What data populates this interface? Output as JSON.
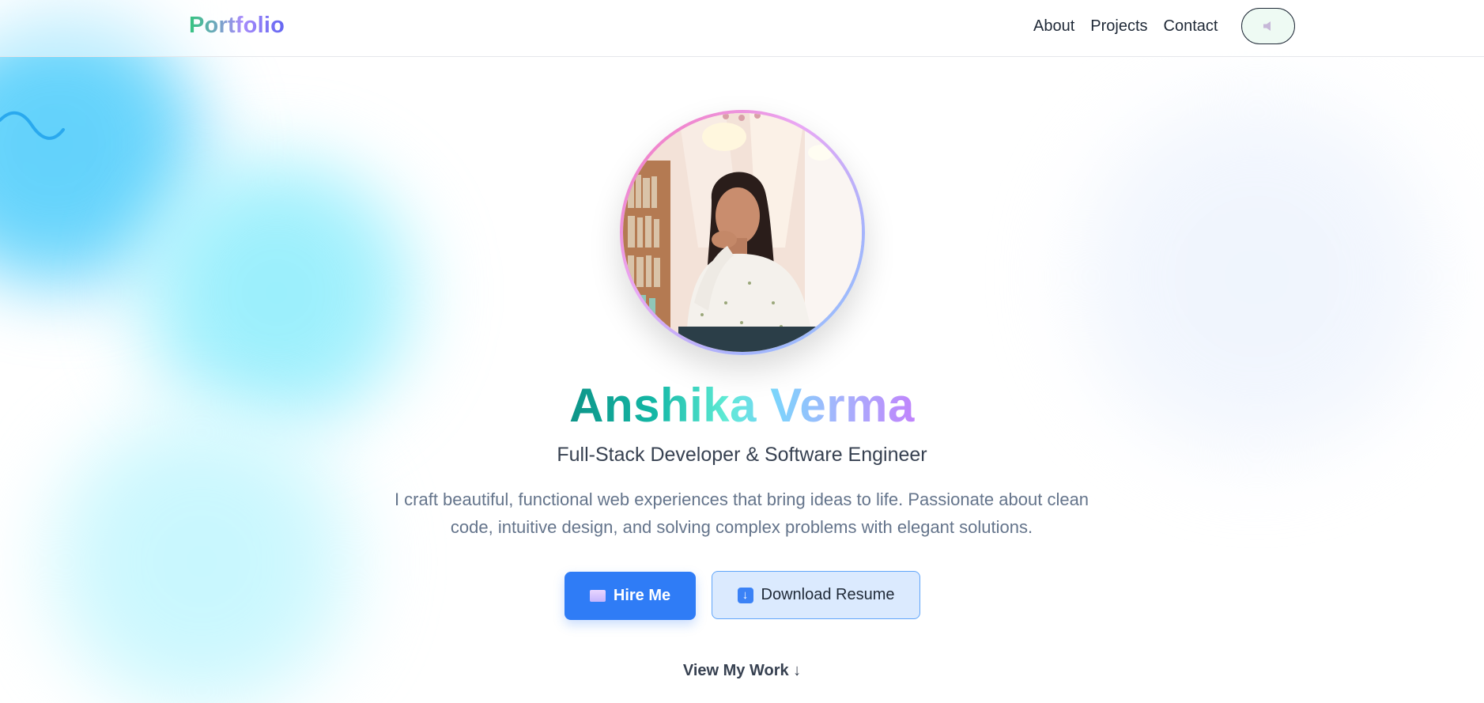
{
  "nav": {
    "logo": "Portfolio",
    "links": [
      {
        "label": "About"
      },
      {
        "label": "Projects"
      },
      {
        "label": "Contact"
      }
    ],
    "sound_toggle_icon": "speaker-icon"
  },
  "hero": {
    "name": "Anshika Verma",
    "title": "Full-Stack Developer & Software Engineer",
    "description": "I craft beautiful, functional web experiences that bring ideas to life. Passionate about clean code, intuitive design, and solving complex problems with elegant solutions.",
    "hire_button": {
      "icon": "envelope-icon",
      "label": "Hire Me"
    },
    "resume_button": {
      "icon": "download-arrow-icon",
      "label": "Download Resume"
    },
    "view_work": "View My Work ↓",
    "avatar_icon": "profile-photo"
  },
  "colors": {
    "primary": "#2f7cf6",
    "accent_teal": "#0d9488",
    "accent_violet": "#c084fc",
    "blob_blue": "#5fd0fb",
    "blob_cyan": "#a6f1fd"
  }
}
